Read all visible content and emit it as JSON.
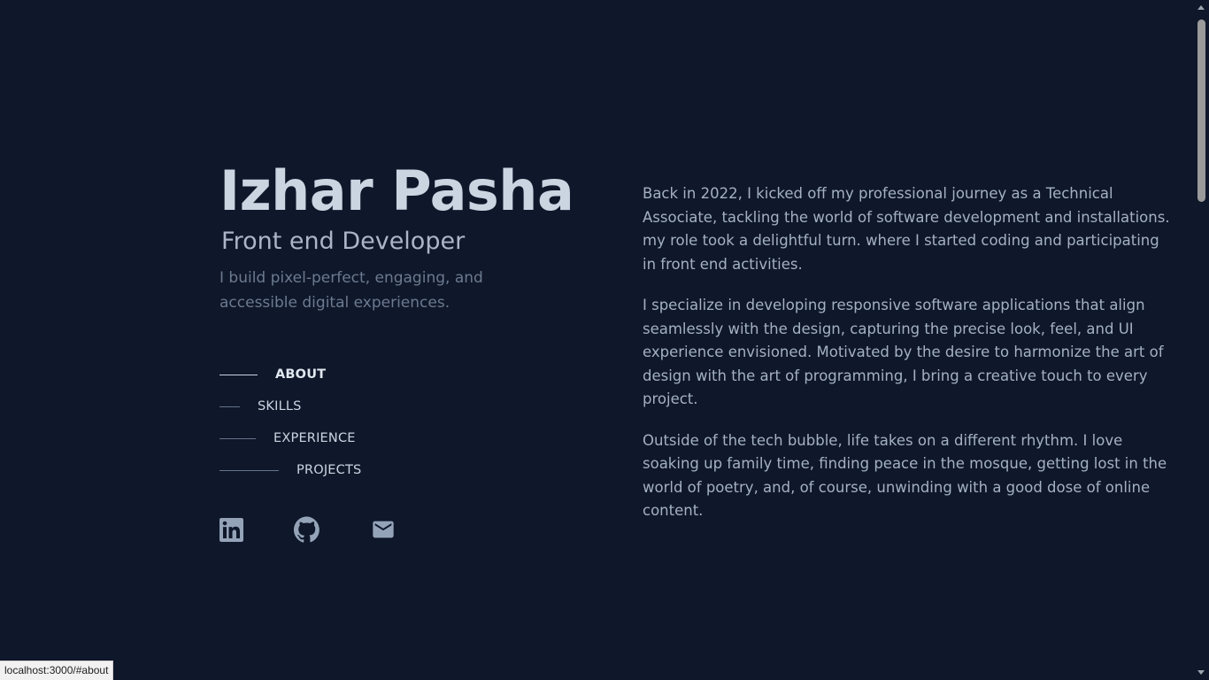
{
  "header": {
    "name": "Izhar Pasha",
    "role": "Front end Developer",
    "tagline": "I build pixel-perfect, engaging, and accessible digital experiences."
  },
  "nav": {
    "items": [
      {
        "label": "ABOUT",
        "active": true
      },
      {
        "label": "SKILLS",
        "active": false
      },
      {
        "label": "EXPERIENCE",
        "active": false
      },
      {
        "label": "PROJECTS",
        "active": false
      }
    ]
  },
  "social": {
    "icons": [
      "linkedin-icon",
      "github-icon",
      "mail-icon"
    ]
  },
  "about": {
    "paragraphs": [
      "Back in 2022, I kicked off my professional journey as a Technical Associate, tackling the world of software development and installations. my role took a delightful turn. where I started coding and participating in front end activities.",
      "I specialize in developing responsive software applications that align seamlessly with the design, capturing the precise look, feel, and UI experience envisioned. Motivated by the desire to harmonize the art of design with the art of programming, I bring a creative touch to every project.",
      "Outside of the tech bubble, life takes on a different rhythm. I love soaking up family time, finding peace in the mosque, getting lost in the world of poetry, and, of course, unwinding with a good dose of online content."
    ]
  },
  "status_bar": {
    "url": "localhost:3000/#about"
  },
  "colors": {
    "background": "#0f172a",
    "heading": "#cbd5e1",
    "text": "#94a3b8"
  }
}
